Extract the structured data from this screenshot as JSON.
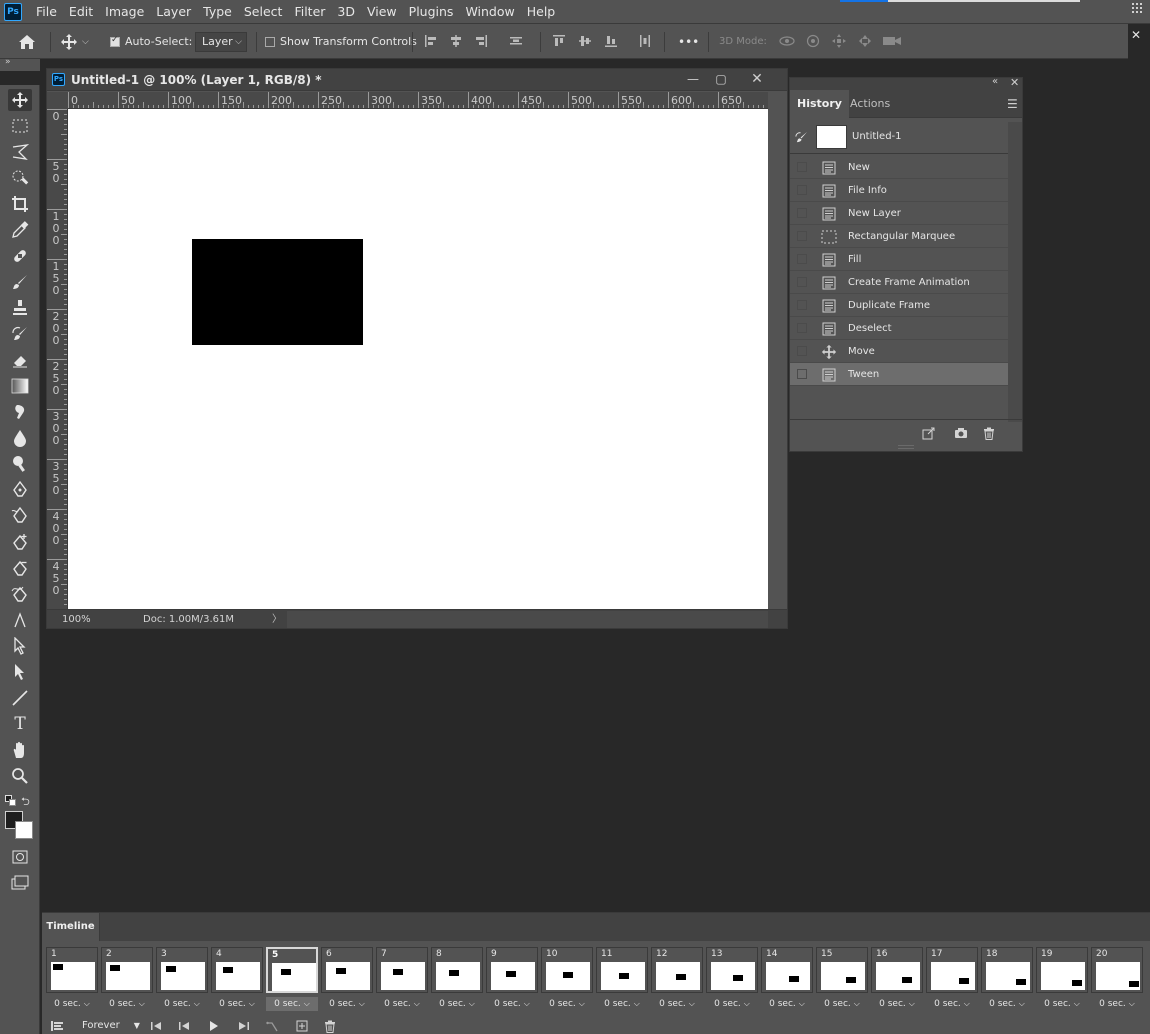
{
  "app": {
    "logo_text": "Ps"
  },
  "menu": [
    "File",
    "Edit",
    "Image",
    "Layer",
    "Type",
    "Select",
    "Filter",
    "3D",
    "View",
    "Plugins",
    "Window",
    "Help"
  ],
  "options_bar": {
    "auto_select_label": "Auto-Select:",
    "auto_select_checked": true,
    "layer_dropdown_value": "Layer",
    "show_transform_label": "Show Transform Controls",
    "show_transform_checked": false,
    "more_label": "•••",
    "mode_3d_label": "3D Mode:"
  },
  "document": {
    "title": "Untitled-1 @ 100% (Layer 1, RGB/8) *",
    "zoom": "100%",
    "doc_info": "Doc: 1.00M/3.61M",
    "hruler_labels": [
      "0",
      "50",
      "100",
      "150",
      "200",
      "250",
      "300",
      "350",
      "400",
      "450",
      "500",
      "550",
      "600",
      "650"
    ],
    "vruler_labels": [
      [
        "0"
      ],
      [
        "5",
        "0"
      ],
      [
        "1",
        "0",
        "0"
      ],
      [
        "1",
        "5",
        "0"
      ],
      [
        "2",
        "0",
        "0"
      ],
      [
        "2",
        "5",
        "0"
      ],
      [
        "3",
        "0",
        "0"
      ],
      [
        "3",
        "5",
        "0"
      ],
      [
        "4",
        "0",
        "0"
      ],
      [
        "4",
        "5",
        "0"
      ]
    ]
  },
  "history_panel": {
    "tabs": [
      "History",
      "Actions"
    ],
    "active_tab": "History",
    "snapshot_label": "Untitled-1",
    "items": [
      {
        "label": "New",
        "icon": "document-icon"
      },
      {
        "label": "File Info",
        "icon": "document-icon"
      },
      {
        "label": "New Layer",
        "icon": "document-icon"
      },
      {
        "label": "Rectangular Marquee",
        "icon": "marquee-icon"
      },
      {
        "label": "Fill",
        "icon": "document-icon"
      },
      {
        "label": "Create Frame Animation",
        "icon": "document-icon"
      },
      {
        "label": "Duplicate Frame",
        "icon": "document-icon"
      },
      {
        "label": "Deselect",
        "icon": "document-icon"
      },
      {
        "label": "Move",
        "icon": "move-icon"
      },
      {
        "label": "Tween",
        "icon": "document-icon"
      }
    ],
    "selected_item": "Tween"
  },
  "timeline": {
    "tab_label": "Timeline",
    "selected_frame": 5,
    "loop": "Forever",
    "frames": [
      {
        "num": "1",
        "delay": "0 sec."
      },
      {
        "num": "2",
        "delay": "0 sec."
      },
      {
        "num": "3",
        "delay": "0 sec."
      },
      {
        "num": "4",
        "delay": "0 sec."
      },
      {
        "num": "5",
        "delay": "0 sec."
      },
      {
        "num": "6",
        "delay": "0 sec."
      },
      {
        "num": "7",
        "delay": "0 sec."
      },
      {
        "num": "8",
        "delay": "0 sec."
      },
      {
        "num": "9",
        "delay": "0 sec."
      },
      {
        "num": "10",
        "delay": "0 sec."
      },
      {
        "num": "11",
        "delay": "0 sec."
      },
      {
        "num": "12",
        "delay": "0 sec."
      },
      {
        "num": "13",
        "delay": "0 sec."
      },
      {
        "num": "14",
        "delay": "0 sec."
      },
      {
        "num": "15",
        "delay": "0 sec."
      },
      {
        "num": "16",
        "delay": "0 sec."
      },
      {
        "num": "17",
        "delay": "0 sec."
      },
      {
        "num": "18",
        "delay": "0 sec."
      },
      {
        "num": "19",
        "delay": "0 sec."
      },
      {
        "num": "20",
        "delay": "0 sec."
      }
    ]
  },
  "colors": {
    "foreground": "#1e1e1e",
    "background": "#ffffff",
    "accent": "#31a8ff"
  }
}
